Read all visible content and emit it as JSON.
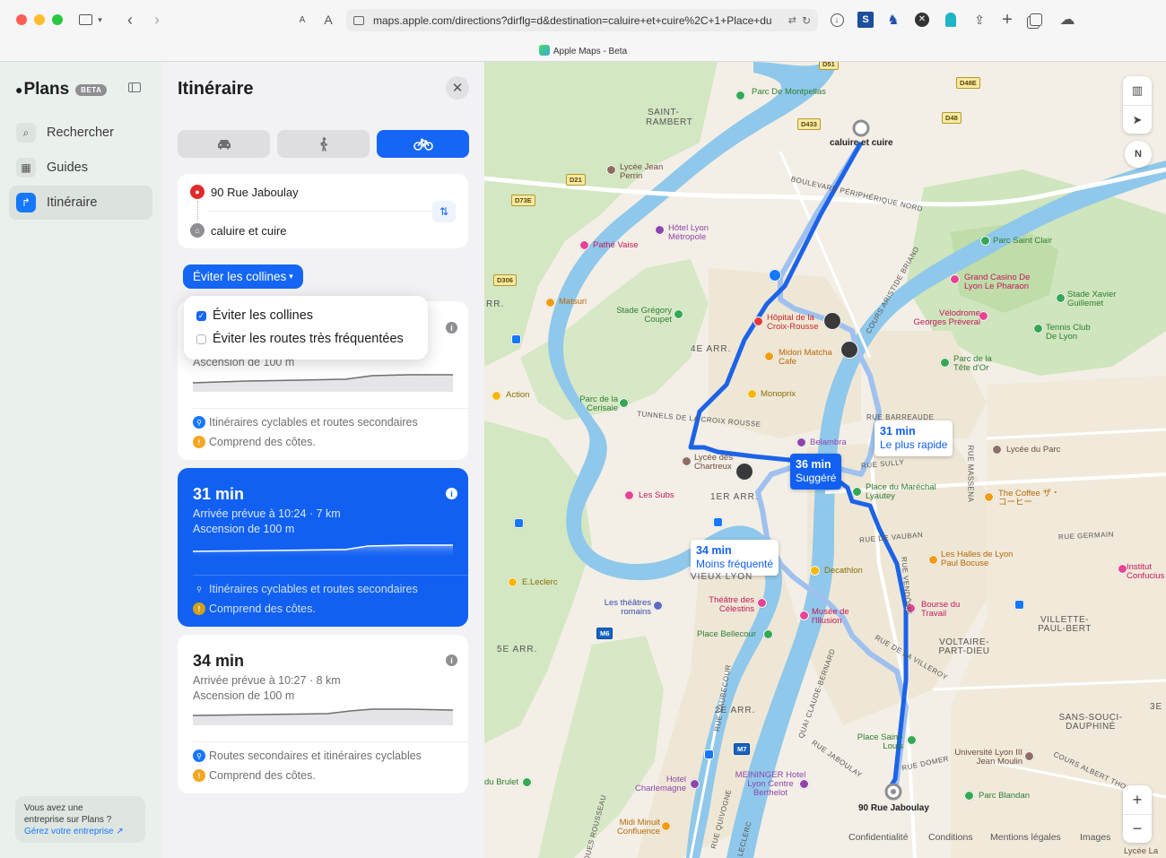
{
  "browser": {
    "url": "maps.apple.com/directions?dirflg=d&destination=caluire+et+cuire%2C+1+Place+du",
    "tab_title": "Apple Maps - Beta",
    "text_small": "A",
    "text_large": "A"
  },
  "sidebar": {
    "brand": "Plans",
    "beta": "BETA",
    "items": [
      {
        "label": "Rechercher",
        "icon": "search-icon"
      },
      {
        "label": "Guides",
        "icon": "guides-icon"
      },
      {
        "label": "Itinéraire",
        "icon": "directions-icon"
      }
    ],
    "promo": {
      "line1": "Vous avez une",
      "line2": "entreprise sur Plans ?",
      "link": "Gérez votre entreprise ↗"
    }
  },
  "panel": {
    "title": "Itinéraire",
    "active_mode": "cycling",
    "origin": "90 Rue Jaboulay",
    "destination": "caluire et cuire",
    "filter_label": "Éviter les collines",
    "options": [
      {
        "label": "Éviter les collines",
        "checked": true
      },
      {
        "label": "Éviter les routes très fréquentées",
        "checked": false
      }
    ],
    "routes": [
      {
        "ascent": "Ascension de 100 m",
        "feature": "Itinéraires cyclables et routes secondaires",
        "warning": "Comprend des côtes."
      },
      {
        "time": "31 min",
        "details": "Arrivée prévue à 10:24 · 7 km",
        "ascent": "Ascension de 100 m",
        "feature": "Itinéraires cyclables et routes secondaires",
        "warning": "Comprend des côtes.",
        "selected": true
      },
      {
        "time": "34 min",
        "details": "Arrivée prévue à 10:27 · 8 km",
        "ascent": "Ascension de 100 m",
        "feature": "Routes secondaires et itinéraires cyclables",
        "warning": "Comprend des côtes."
      }
    ]
  },
  "map": {
    "callouts": [
      {
        "time": "36 min",
        "sub": "Suggéré"
      },
      {
        "time": "31 min",
        "sub": "Le plus rapide"
      },
      {
        "time": "34 min",
        "sub": "Moins fréquenté"
      }
    ],
    "places": {
      "destination": "caluire et cuire",
      "origin": "90 Rue Jaboulay",
      "p01": "Parc De Montpellas",
      "p02": "SAINT-",
      "p03": "RAMBERT",
      "p04": "Lycée Jean Perrin",
      "p05": "Hôtel Lyon Métropole",
      "p06": "Pathé Vaise",
      "p07": "Parc Saint Clair",
      "p08": "Grand Casino De Lyon Le Pharaon",
      "p09": "Stade Xavier Guillemet",
      "p10": "Vélodrome Georges Préveral",
      "p11": "Tennis Club De Lyon",
      "p12": "Parc de la Tête d'Or",
      "p13": "Matsuri",
      "p14": "Stade Grégory Coupet",
      "p15": "Hôpital de la Croix-Rousse",
      "p16": "Midori Matcha Cafe",
      "p17": "Monoprix",
      "p18": "Action",
      "p19": "Parc de la Cerisaie",
      "p20": "Belambra",
      "p21": "Lycée des Chartreux",
      "p22": "Les Subs",
      "p23": "Place du Maréchal Lyautey",
      "p24": "Lycée du Parc",
      "p25": "The Coffee ザ・コーヒー",
      "p26": "E.Leclerc",
      "p27": "Decathlon",
      "p28": "Les Halles de Lyon Paul Bocuse",
      "p29": "Les théâtres romains",
      "p30": "Théâtre des Célestins",
      "p31": "Musée de l'Illusion",
      "p32": "Bourse du Travail",
      "p33": "Place Bellecour",
      "p34": "VILLETTE-PAUL-BERT",
      "p35": "VOLTAIRE-PART-DIEU",
      "p36": "SANS-SOUCI-DAUPHINÉ",
      "p37": "Place Saint-Louis",
      "p38": "Université Lyon III Jean Moulin",
      "p39": "Hotel Charlemagne",
      "p40": "MEININGER Hotel Lyon Centre Berthelot",
      "p41": "Parc Blandan",
      "p42": "Midi Minuit Confluence",
      "p43": "Institut Confucius",
      "p44": "Lycée La",
      "p45": "du Brulet"
    },
    "districts": [
      "4E ARR.",
      "1ER ARR.",
      "VIEUX LYON",
      "5E ARR.",
      "2E ARR.",
      "3E",
      "RR."
    ],
    "roads": [
      "BOULEVARD PÉRIPHÉRIQUE NORD",
      "TUNNELS DE LA CROIX ROUSSE",
      "COURS ARISTIDE BRIAND",
      "RUE BARREAUDE",
      "RUE MASSENA",
      "RUE DE VAUBAN",
      "RUE GERMAIN",
      "RUE VENDÔME",
      "RUE DE LA VILLEROY",
      "RUE DOMER",
      "COURS ALBERT THOMAS",
      "QUAI CLAUDE-BERNARD",
      "RUE VAUBECOUR",
      "RUE SULLY",
      "RUE JABOULAY",
      "RUE QUIVOGNE",
      "JACQUES ROUSSEAU",
      "LECLERC",
      "M6",
      "M7"
    ],
    "shields": [
      "D51",
      "D48E",
      "D433",
      "D48",
      "D21",
      "D73E",
      "D306"
    ],
    "compass": "N",
    "legal": [
      "Confidentialité",
      "Conditions",
      "Mentions légales",
      "Images"
    ]
  }
}
